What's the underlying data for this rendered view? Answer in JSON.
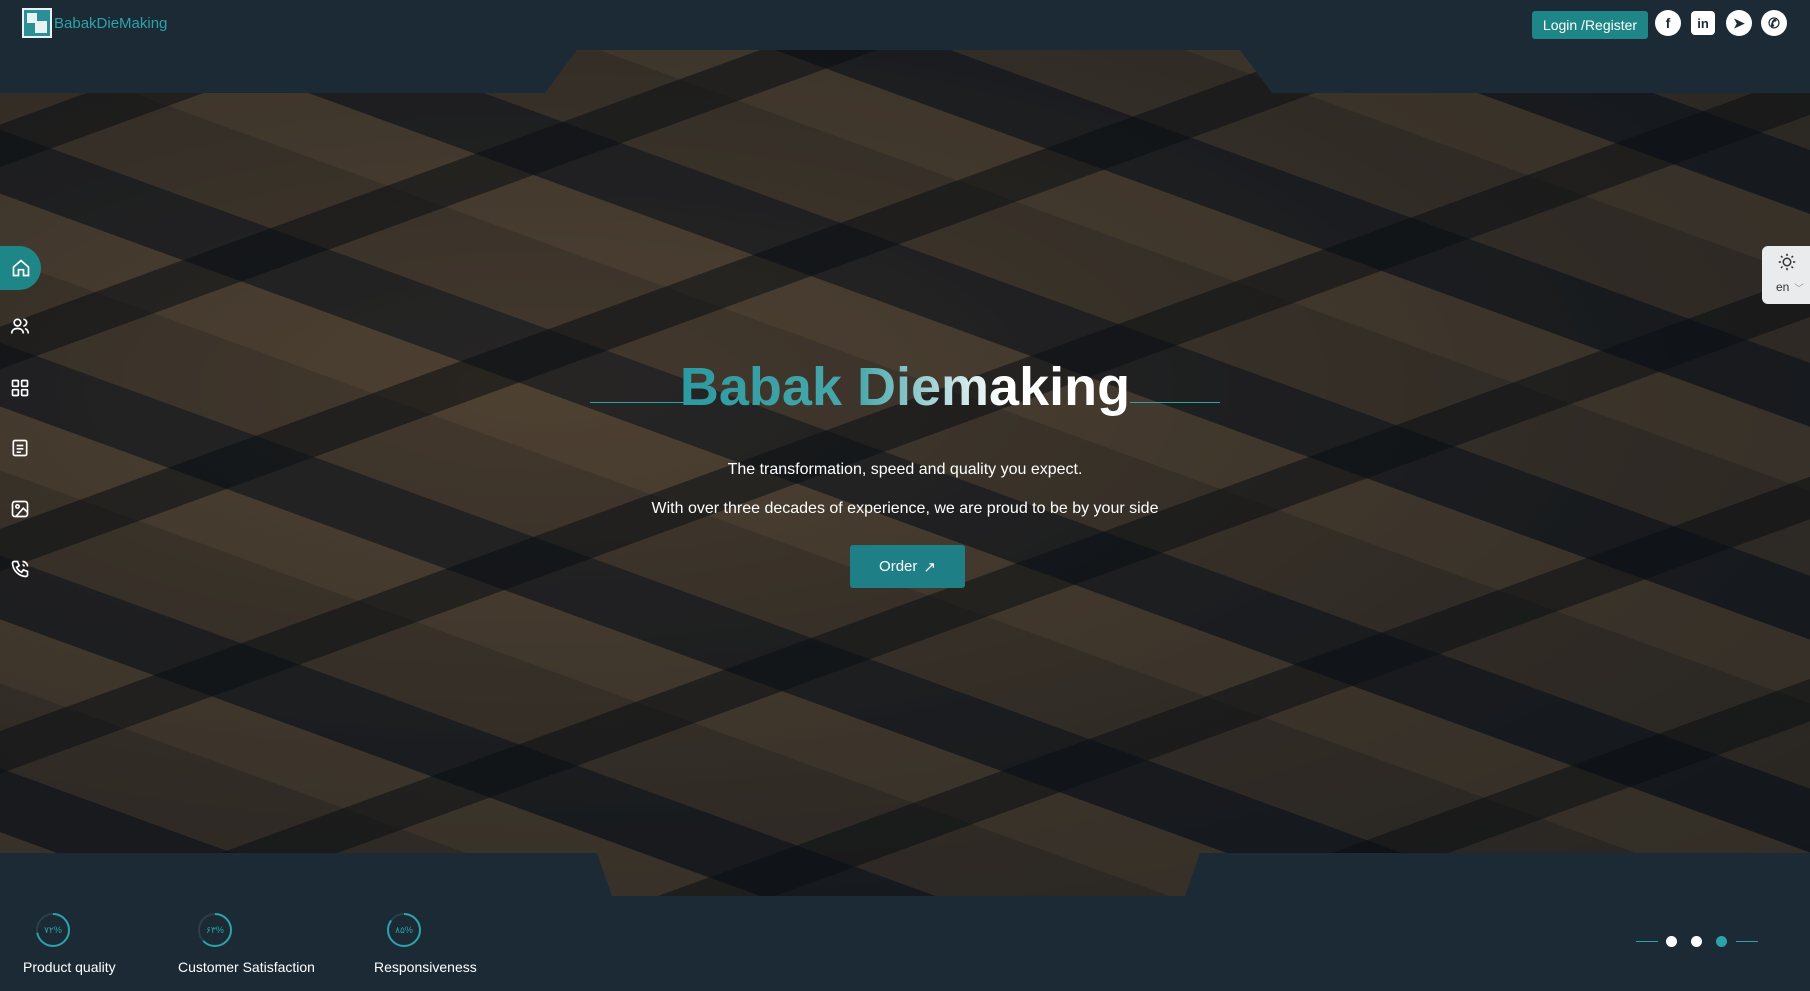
{
  "brand": {
    "name": "BabakDieMaking"
  },
  "header": {
    "login_label": "Login /Register"
  },
  "social": [
    {
      "icon": "facebook-icon",
      "glyph": "f"
    },
    {
      "icon": "linkedin-icon",
      "glyph": "in"
    },
    {
      "icon": "telegram-icon",
      "glyph": "➤"
    },
    {
      "icon": "whatsapp-icon",
      "glyph": "✆"
    }
  ],
  "hero": {
    "title": "Babak Diemaking",
    "tagline_1": "The transformation, speed and quality you expect.",
    "tagline_2": "With over three decades of experience, we are proud to be by your side",
    "order_label": "Order",
    "order_icon": "↗"
  },
  "sidebar": {
    "items": [
      {
        "icon": "home-icon",
        "active": true
      },
      {
        "icon": "users-icon",
        "active": false
      },
      {
        "icon": "grid-icon",
        "active": false
      },
      {
        "icon": "document-icon",
        "active": false
      },
      {
        "icon": "image-icon",
        "active": false
      },
      {
        "icon": "phone-icon",
        "active": false
      }
    ]
  },
  "settings": {
    "language": "en",
    "chevron": "﹀",
    "theme_icon": "sun-icon"
  },
  "stats": [
    {
      "label": "Product quality",
      "percent_text": "۷۲%",
      "value": 72
    },
    {
      "label": "Customer Satisfaction",
      "percent_text": "۶۳%",
      "value": 63
    },
    {
      "label": "Responsiveness",
      "percent_text": "۸۵%",
      "value": 85
    }
  ],
  "slider": {
    "count": 3,
    "active_index": 2
  },
  "colors": {
    "background": "#1b2a35",
    "accent": "#1f8688",
    "accent_light": "#2ba3a8"
  }
}
